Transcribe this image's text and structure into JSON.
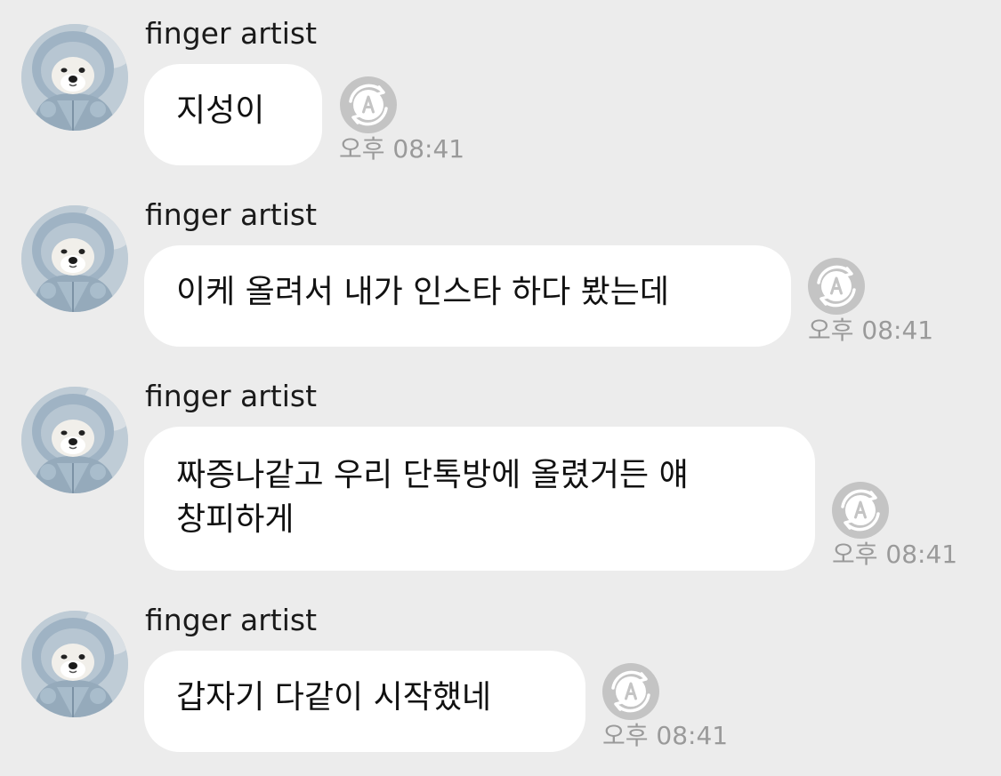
{
  "colors": {
    "background": "#ececec",
    "bubble": "#ffffff",
    "text": "#111111",
    "timestamp": "#9a9a9a",
    "icon": "#c4c4c4"
  },
  "messages": [
    {
      "sender": "finger artist",
      "lines": [
        "지성이"
      ],
      "time": "오후 08:41",
      "avatar_icon": "dog-avatar-icon",
      "action_icon": "translate-icon"
    },
    {
      "sender": "finger artist",
      "lines": [
        "이케 올려서 내가 인스타 하다 봤는데"
      ],
      "time": "오후 08:41",
      "avatar_icon": "dog-avatar-icon",
      "action_icon": "translate-icon"
    },
    {
      "sender": "finger artist",
      "lines": [
        "짜증나같고 우리 단톡방에 올렸거든 얘",
        "창피하게"
      ],
      "time": "오후 08:41",
      "avatar_icon": "dog-avatar-icon",
      "action_icon": "translate-icon"
    },
    {
      "sender": "finger artist",
      "lines": [
        "갑자기 다같이 시작했네"
      ],
      "time": "오후 08:41",
      "avatar_icon": "dog-avatar-icon",
      "action_icon": "translate-icon"
    }
  ]
}
